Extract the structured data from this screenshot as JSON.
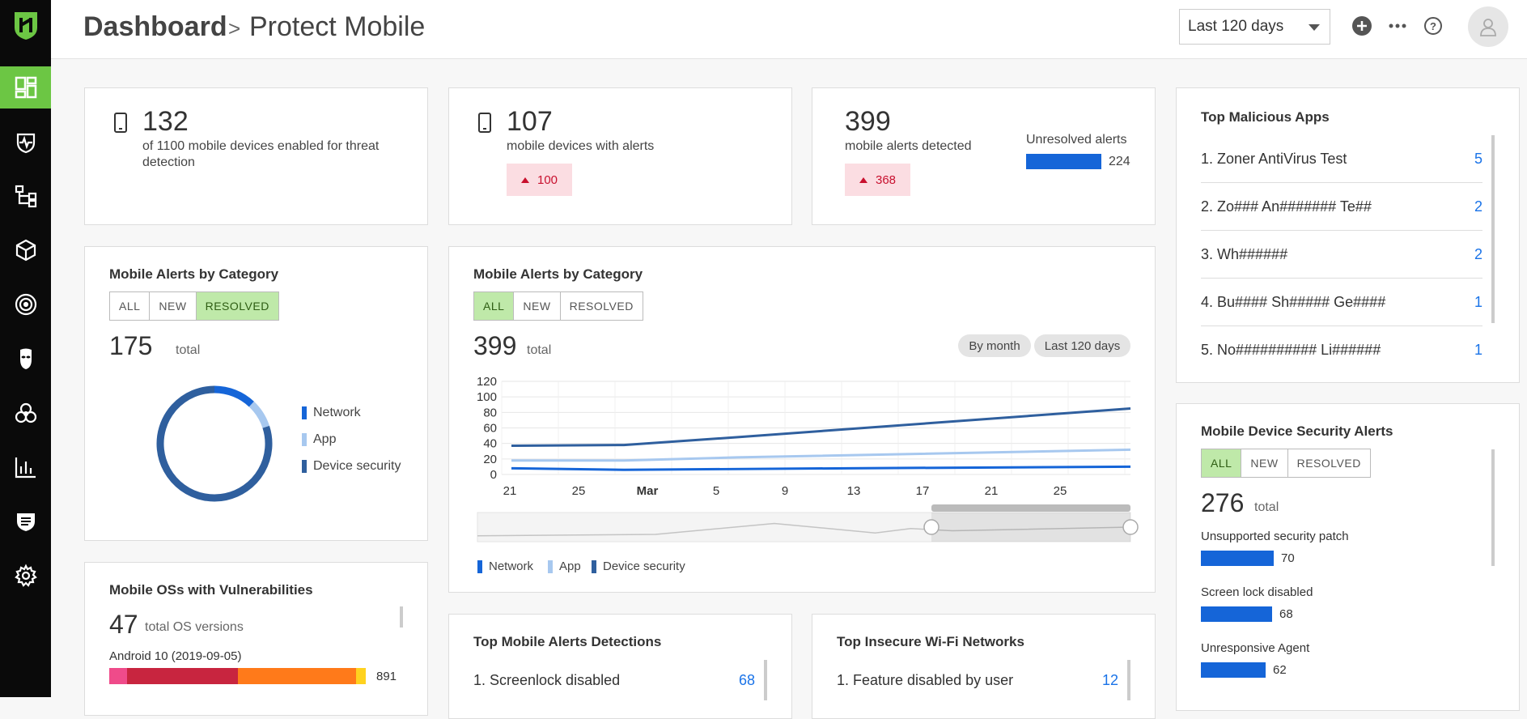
{
  "header": {
    "breadcrumb_root": "Dashboard",
    "breadcrumb_sep": ">",
    "page_title": "Protect Mobile",
    "date_range": "Last 120 days"
  },
  "colors": {
    "accent_green": "#6cc644",
    "network": "#1565d8",
    "app": "#a7c8ef",
    "device_security": "#2f5f9e",
    "alert_red": "#c8102e"
  },
  "sidebar": {
    "icons": [
      "logo-icon",
      "dashboard-icon",
      "heartbeat-shield-icon",
      "hierarchy-icon",
      "cube-icon",
      "target-icon",
      "mask-icon",
      "biohazard-icon",
      "bar-chart-icon",
      "shield-list-icon",
      "gear-icon"
    ]
  },
  "stats": {
    "enabled": {
      "value": "132",
      "label": "of 1100 mobile devices enabled for threat detection"
    },
    "with_alerts": {
      "value": "107",
      "label": "mobile devices with alerts",
      "delta": "100"
    },
    "detected": {
      "value": "399",
      "label": "mobile alerts detected",
      "delta": "368",
      "unresolved_label": "Unresolved alerts",
      "unresolved_value": "224",
      "unresolved_fraction": 0.56
    }
  },
  "donut_card": {
    "title": "Mobile Alerts by Category",
    "filters": [
      "ALL",
      "NEW",
      "RESOLVED"
    ],
    "active_filter": "RESOLVED",
    "total": "175",
    "total_label": "total",
    "legend": [
      "Network",
      "App",
      "Device security"
    ],
    "slices": [
      {
        "name": "Network",
        "fraction": 0.12
      },
      {
        "name": "App",
        "fraction": 0.08
      },
      {
        "name": "Device security",
        "fraction": 0.8
      }
    ]
  },
  "line_card": {
    "title": "Mobile Alerts by Category",
    "filters": [
      "ALL",
      "NEW",
      "RESOLVED"
    ],
    "active_filter": "ALL",
    "total": "399",
    "total_label": "total",
    "pill_month": "By month",
    "pill_range": "Last 120 days",
    "legend": [
      "Network",
      "App",
      "Device security"
    ]
  },
  "chart_data": {
    "type": "line",
    "x": [
      "21",
      "25",
      "Mar",
      "5",
      "9",
      "13",
      "17",
      "21",
      "25"
    ],
    "yticks": [
      "120",
      "100",
      "80",
      "60",
      "40",
      "20",
      "0"
    ],
    "ylim": [
      0,
      120
    ],
    "series": [
      {
        "name": "Network",
        "points": [
          [
            0,
            8
          ],
          [
            2,
            6
          ],
          [
            6,
            8
          ],
          [
            11,
            10
          ]
        ]
      },
      {
        "name": "App",
        "points": [
          [
            0,
            18
          ],
          [
            2,
            18
          ],
          [
            4,
            22
          ],
          [
            11,
            32
          ]
        ]
      },
      {
        "name": "Device security",
        "points": [
          [
            0,
            37
          ],
          [
            2,
            38
          ],
          [
            4,
            48
          ],
          [
            11,
            85
          ]
        ]
      }
    ],
    "navigator": [
      [
        0,
        8
      ],
      [
        3,
        10
      ],
      [
        5,
        25
      ],
      [
        6.7,
        12
      ],
      [
        7.3,
        18
      ],
      [
        8,
        15
      ],
      [
        11,
        20
      ]
    ]
  },
  "malicious_apps": {
    "title": "Top Malicious Apps",
    "items": [
      {
        "name": "1. Zoner AntiVirus Test",
        "count": "5"
      },
      {
        "name": "2. Zo### An####### Te##",
        "count": "2"
      },
      {
        "name": "3. Wh######",
        "count": "2"
      },
      {
        "name": "4. Bu#### Sh##### Ge####",
        "count": "1"
      },
      {
        "name": "5. No########## Li######",
        "count": "1"
      }
    ]
  },
  "security_alerts": {
    "title": "Mobile Device Security Alerts",
    "filters": [
      "ALL",
      "NEW",
      "RESOLVED"
    ],
    "active_filter": "ALL",
    "total": "276",
    "total_label": "total",
    "items": [
      {
        "label": "Unsupported security patch",
        "value": "70"
      },
      {
        "label": "Screen lock disabled",
        "value": "68"
      },
      {
        "label": "Unresponsive Agent",
        "value": "62"
      }
    ]
  },
  "os_vuln": {
    "title": "Mobile OSs with Vulnerabilities",
    "total": "47",
    "total_label": "total OS versions",
    "first_os": "Android 10 (2019-09-05)",
    "first_value": "891"
  },
  "detections": {
    "title": "Top Mobile Alerts Detections",
    "first": "1. Screenlock disabled",
    "first_count": "68"
  },
  "wifi": {
    "title": "Top Insecure Wi-Fi Networks",
    "first": "1. Feature disabled by user",
    "first_count": "12"
  }
}
